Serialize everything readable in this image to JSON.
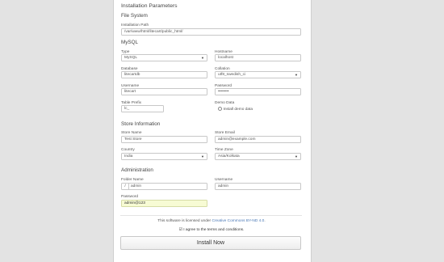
{
  "title": "Installation Parameters",
  "file_system": {
    "heading": "File System",
    "path_label": "Installation Path",
    "path_value": "/var/www/html/litecart/public_html/"
  },
  "mysql": {
    "heading": "MySQL",
    "type_label": "Type",
    "type_value": "MySQL",
    "hostname_label": "Hostname",
    "hostname_value": "localhost",
    "database_label": "Database",
    "database_value": "litecartdb",
    "collation_label": "Collation",
    "collation_value": "utf8_swedish_ci",
    "username_label": "Username",
    "username_value": "litecart",
    "password_label": "Password",
    "password_value": "••••••••",
    "prefix_label": "Table Prefix",
    "prefix_value": "lc_",
    "demo_label": "Demo Data",
    "demo_option": "Install demo data"
  },
  "store": {
    "heading": "Store Information",
    "name_label": "Store Name",
    "name_value": "Test Store",
    "email_label": "Store Email",
    "email_value": "admin@example.com",
    "country_label": "Country",
    "country_value": "India",
    "timezone_label": "Time Zone",
    "timezone_value": "Asia/Kolkata"
  },
  "admin": {
    "heading": "Administration",
    "folder_label": "Folder Name",
    "folder_prefix": "/",
    "folder_value": "admin",
    "username_label": "Username",
    "username_value": "admin",
    "password_label": "Password",
    "password_value": "admin@123"
  },
  "license": {
    "text": "This software is licensed under",
    "link": "Creative Commons BY-ND 4.0",
    "end": "."
  },
  "agree": {
    "mark": "☑",
    "text": "I agree to the terms and conditions."
  },
  "install_button": "Install Now",
  "icons": {
    "dropdown": "caret-down-icon",
    "checkbox": "checkbox-checked-icon"
  },
  "colors": {
    "link": "#4a78b6",
    "highlight_field": "#f7fbd4"
  }
}
